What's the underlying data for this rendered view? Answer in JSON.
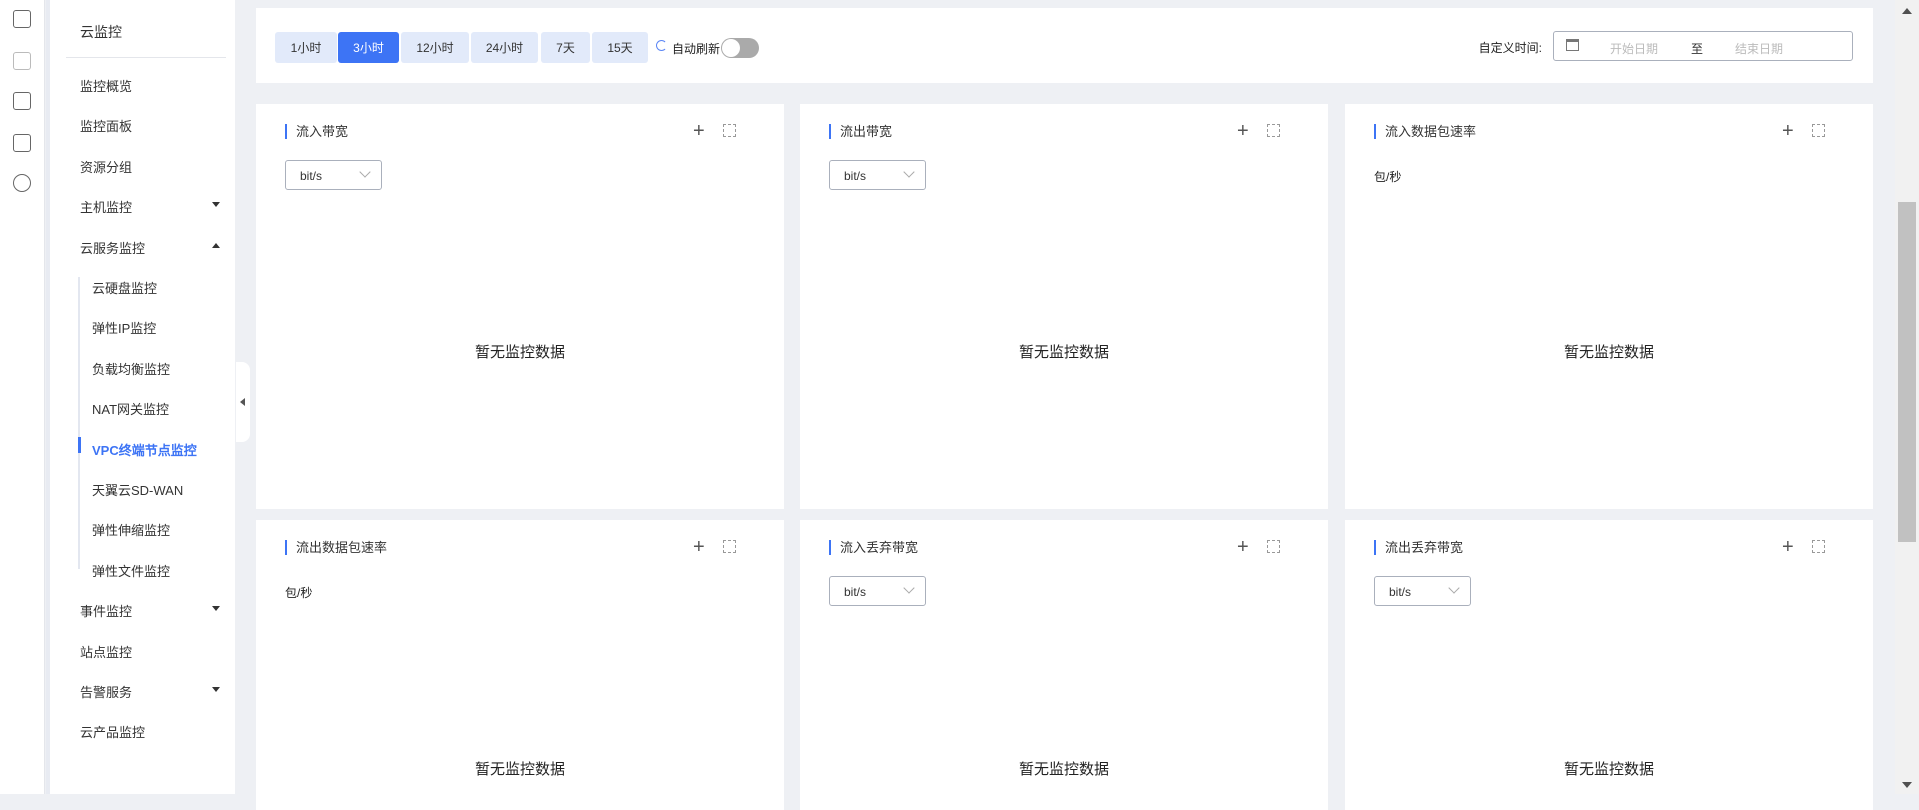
{
  "sidebar": {
    "title": "云监控",
    "items": [
      {
        "label": "监控概览"
      },
      {
        "label": "监控面板"
      },
      {
        "label": "资源分组"
      },
      {
        "label": "主机监控",
        "caret": "down"
      },
      {
        "label": "云服务监控",
        "caret": "up"
      },
      {
        "label": "云硬盘监控",
        "child": true
      },
      {
        "label": "弹性IP监控",
        "child": true
      },
      {
        "label": "负载均衡监控",
        "child": true
      },
      {
        "label": "NAT网关监控",
        "child": true
      },
      {
        "label": "VPC终端节点监控",
        "child": true,
        "active": true
      },
      {
        "label": "天翼云SD-WAN",
        "child": true
      },
      {
        "label": "弹性伸缩监控",
        "child": true
      },
      {
        "label": "弹性文件监控",
        "child": true
      },
      {
        "label": "事件监控",
        "caret": "down"
      },
      {
        "label": "站点监控"
      },
      {
        "label": "告警服务",
        "caret": "down"
      },
      {
        "label": "云产品监控"
      }
    ]
  },
  "toolbar": {
    "ranges": [
      "1小时",
      "3小时",
      "12小时",
      "24小时",
      "7天",
      "15天"
    ],
    "active_range": "3小时",
    "auto_refresh_label": "自动刷新",
    "auto_refresh_on": false,
    "custom_time_label": "自定义时间:",
    "start_placeholder": "开始日期",
    "range_separator": "至",
    "end_placeholder": "结束日期"
  },
  "panels": [
    {
      "title": "流入带宽",
      "unit_select": "bit/s",
      "empty": "暂无监控数据"
    },
    {
      "title": "流出带宽",
      "unit_select": "bit/s",
      "empty": "暂无监控数据"
    },
    {
      "title": "流入数据包速率",
      "unit_label": "包/秒",
      "empty": "暂无监控数据"
    },
    {
      "title": "流出数据包速率",
      "unit_label": "包/秒",
      "empty": "暂无监控数据"
    },
    {
      "title": "流入丢弃带宽",
      "unit_select": "bit/s",
      "empty": "暂无监控数据"
    },
    {
      "title": "流出丢弃带宽",
      "unit_select": "bit/s",
      "empty": "暂无监控数据"
    }
  ],
  "colors": {
    "accent": "#3d74f5",
    "button_bg": "#e2eafa",
    "page_bg": "#eef0f4"
  }
}
